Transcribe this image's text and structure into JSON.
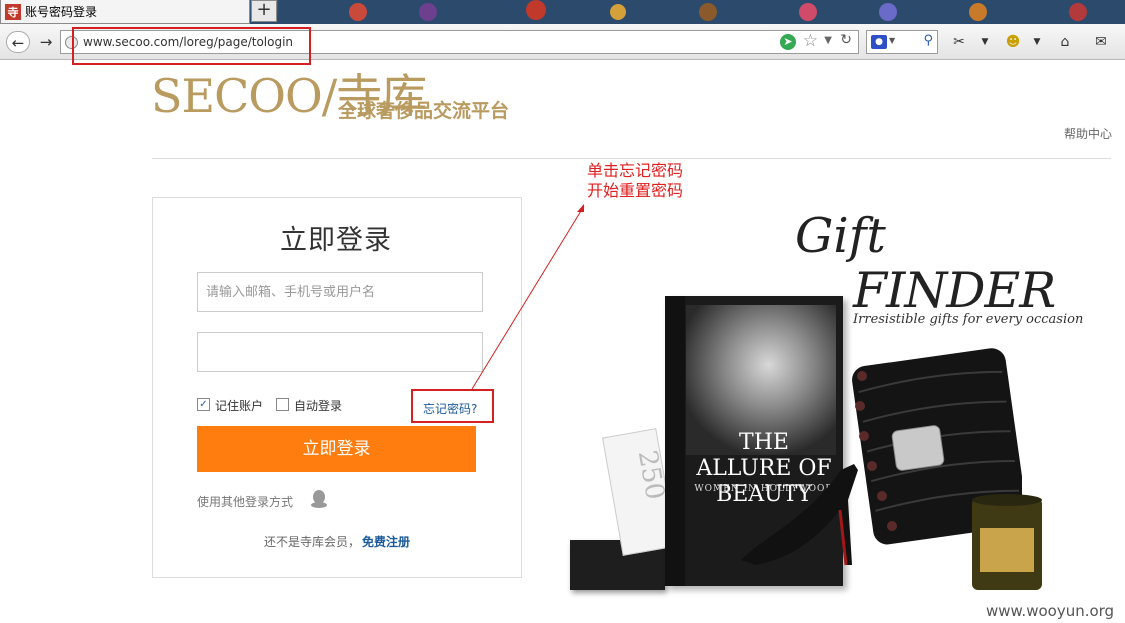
{
  "browser": {
    "tab_title": "账号密码登录",
    "tab_favicon": "寺",
    "newtab_label": "+",
    "url": "www.secoo.com/loreg/page/tologin"
  },
  "icons": {
    "back": "back-arrow-icon",
    "forward": "forward-arrow-icon",
    "globe": "globe-icon",
    "go": "go-arrow-icon",
    "bookmark": "star-icon",
    "reload": "reload-icon",
    "search_engine": "baidu-paw-icon",
    "search": "search-icon",
    "screenshot": "screenshot-icon",
    "addon": "addon-icon",
    "home": "home-icon",
    "mail": "mail-icon",
    "qq": "qq-icon"
  },
  "header": {
    "logo_text": "SECOO/寺库",
    "slogan": "全球奢侈品交流平台",
    "help": "帮助中心"
  },
  "login": {
    "title": "立即登录",
    "username_placeholder": "请输入邮箱、手机号或用户名",
    "password_placeholder": "",
    "remember_label": "记住账户",
    "remember_checked": true,
    "auto_login_label": "自动登录",
    "auto_login_checked": false,
    "forgot_label": "忘记密码?",
    "submit_label": "立即登录",
    "other_login_label": "使用其他登录方式",
    "register_prompt": "还不是寺库会员，",
    "register_link": "免费注册"
  },
  "annotation": {
    "line1": "单击忘记密码",
    "line2": "开始重置密码"
  },
  "promo": {
    "title": "Gift",
    "subtitle": "FINDER",
    "tagline": "Irresistible gifts for every occasion",
    "book_title": "THE ALLURE OF BEAUTY",
    "book_subtitle": "WOMEN IN HOLLYWOOD",
    "card_number": "250"
  },
  "watermark": "www.wooyun.org",
  "colors": {
    "brand_gold": "#b99a5f",
    "login_button": "#ff7d0f",
    "link_blue": "#1a5a9a",
    "annotation_red": "#e02020"
  }
}
